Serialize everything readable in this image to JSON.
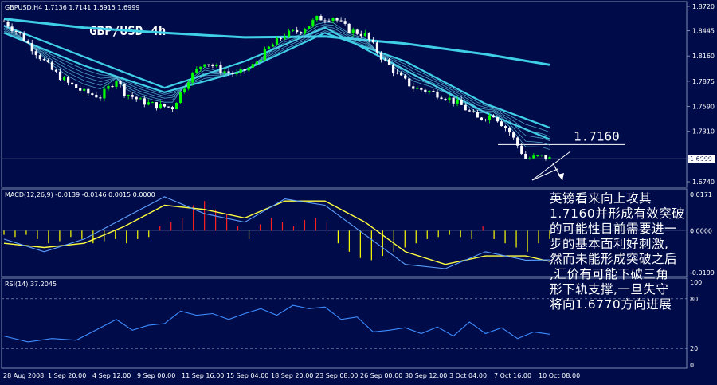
{
  "main_header": "GBPUSD,H4  1.7136 1.7141 1.6915 1.6999",
  "chart_title": "GBP/USD 4h",
  "level_label": "1.7160",
  "price_axis": [
    "1.8720",
    "1.8445",
    "1.8160",
    "1.7875",
    "1.7590",
    "1.7310",
    "1.6999",
    "1.6740"
  ],
  "macd_header": "MACD(12,26,9) -0.0139 -0.0146 0.0015 0.0000",
  "macd_axis": [
    "0.0171",
    "0.0000",
    "-0.0199"
  ],
  "rsi_header": "RSI(14) 37.2045",
  "rsi_axis": [
    "100",
    "80",
    "20",
    "0"
  ],
  "time_axis": [
    "28 Aug 2008",
    "1 Sep 20:00",
    "4 Sep 12:00",
    "9 Sep 00:00",
    "11 Sep 16:00",
    "15 Sep 04:00",
    "18 Sep 20:00",
    "23 Sep 08:00",
    "26 Sep 00:00",
    "30 Sep 12:00",
    "3 Oct 04:00",
    "7 Oct 16:00",
    "10 Oct 08:00"
  ],
  "annotation": [
    "英镑看来向上攻其",
    "1.7160并形成有效突破",
    "的可能性目前需要进一",
    "步的基本面利好刺激,",
    "然而未能形成突破之后",
    ",汇价有可能下破三角",
    "形下轨支撑,一旦失守",
    "将向1.6770方向进展"
  ],
  "colors": {
    "background": "#000c4a",
    "bull_candle": "#00ff00",
    "bear_candle": "#ffffff",
    "ma_slow": "#3fd0e8",
    "ma_fast": "#63c6de",
    "macd_pos": "#ff2020",
    "macd_neg": "#ffff00",
    "macd_signal": "#ffff40",
    "macd_line": "#5fa0ff",
    "rsi_line": "#3d8cff"
  },
  "chart_data": {
    "type": "candlestick",
    "title": "GBP/USD 4h",
    "symbol": "GBPUSD",
    "timeframe": "H4",
    "ohlc_last": {
      "open": 1.7136,
      "high": 1.7141,
      "low": 1.6915,
      "close": 1.6999
    },
    "price_ylim": [
      1.674,
      1.872
    ],
    "close_path": [
      [
        0,
        1.855
      ],
      [
        4,
        1.84
      ],
      [
        8,
        1.82
      ],
      [
        12,
        1.8
      ],
      [
        16,
        1.785
      ],
      [
        20,
        1.775
      ],
      [
        24,
        1.77
      ],
      [
        28,
        1.79
      ],
      [
        30,
        1.775
      ],
      [
        34,
        1.765
      ],
      [
        38,
        1.76
      ],
      [
        42,
        1.758
      ],
      [
        46,
        1.79
      ],
      [
        50,
        1.81
      ],
      [
        54,
        1.8
      ],
      [
        58,
        1.795
      ],
      [
        62,
        1.805
      ],
      [
        66,
        1.825
      ],
      [
        70,
        1.84
      ],
      [
        74,
        1.845
      ],
      [
        78,
        1.858
      ],
      [
        82,
        1.86
      ],
      [
        86,
        1.845
      ],
      [
        90,
        1.84
      ],
      [
        94,
        1.815
      ],
      [
        98,
        1.795
      ],
      [
        102,
        1.78
      ],
      [
        106,
        1.776
      ],
      [
        110,
        1.77
      ],
      [
        114,
        1.76
      ],
      [
        118,
        1.745
      ],
      [
        122,
        1.75
      ],
      [
        126,
        1.73
      ],
      [
        130,
        1.7
      ],
      [
        134,
        1.7025
      ],
      [
        136,
        1.6999
      ]
    ],
    "moving_averages": [
      {
        "values": [
          [
            0,
            1.858
          ],
          [
            20,
            1.848
          ],
          [
            40,
            1.842
          ],
          [
            60,
            1.837
          ],
          [
            80,
            1.838
          ],
          [
            100,
            1.83
          ],
          [
            120,
            1.818
          ],
          [
            136,
            1.806
          ]
        ]
      },
      {
        "values": [
          [
            0,
            1.842
          ],
          [
            20,
            1.805
          ],
          [
            40,
            1.775
          ],
          [
            60,
            1.8
          ],
          [
            80,
            1.842
          ],
          [
            100,
            1.81
          ],
          [
            120,
            1.762
          ],
          [
            136,
            1.735
          ]
        ]
      },
      {
        "values": [
          [
            0,
            1.85
          ],
          [
            20,
            1.815
          ],
          [
            40,
            1.78
          ],
          [
            60,
            1.81
          ],
          [
            80,
            1.848
          ],
          [
            100,
            1.8
          ],
          [
            120,
            1.752
          ],
          [
            136,
            1.722
          ]
        ]
      }
    ],
    "resistance_level": 1.716,
    "macd": {
      "params": "12,26,9",
      "values": [
        -0.0139,
        -0.0146,
        0.0015,
        0.0
      ],
      "ylim": [
        -0.0199,
        0.0171
      ],
      "histogram": [
        -0.002,
        -0.003,
        -0.002,
        -0.004,
        -0.006,
        -0.005,
        -0.003,
        -0.004,
        -0.006,
        -0.005,
        -0.004,
        -0.006,
        -0.004,
        -0.003,
        0.002,
        0.004,
        0.006,
        0.012,
        0.014,
        0.01,
        0.008,
        0.002,
        -0.004,
        0.003,
        0.006,
        0.004,
        0.002,
        0.005,
        0.006,
        0.004,
        -0.006,
        -0.01,
        -0.013,
        -0.014,
        -0.012,
        -0.01,
        -0.008,
        -0.006,
        -0.004,
        -0.003,
        -0.002,
        -0.003,
        -0.004,
        0.002,
        -0.004,
        -0.006,
        -0.008,
        -0.01,
        -0.006,
        -0.004
      ],
      "signal": [
        [
          0,
          -0.006
        ],
        [
          10,
          -0.008
        ],
        [
          20,
          -0.006
        ],
        [
          30,
          0.002
        ],
        [
          40,
          0.012
        ],
        [
          50,
          0.01
        ],
        [
          60,
          0.006
        ],
        [
          70,
          0.014
        ],
        [
          80,
          0.014
        ],
        [
          90,
          0.004
        ],
        [
          100,
          -0.01
        ],
        [
          110,
          -0.016
        ],
        [
          120,
          -0.012
        ],
        [
          130,
          -0.012
        ],
        [
          136,
          -0.0146
        ]
      ],
      "main": [
        [
          0,
          -0.004
        ],
        [
          10,
          -0.01
        ],
        [
          20,
          -0.004
        ],
        [
          30,
          0.006
        ],
        [
          40,
          0.016
        ],
        [
          50,
          0.008
        ],
        [
          60,
          0.004
        ],
        [
          70,
          0.015
        ],
        [
          80,
          0.012
        ],
        [
          90,
          -0.002
        ],
        [
          100,
          -0.016
        ],
        [
          110,
          -0.018
        ],
        [
          120,
          -0.01
        ],
        [
          130,
          -0.014
        ],
        [
          136,
          -0.0139
        ]
      ]
    },
    "rsi": {
      "period": 14,
      "value": 37.2045,
      "levels": [
        80,
        20
      ],
      "ylim": [
        0,
        100
      ],
      "values": [
        [
          0,
          35
        ],
        [
          6,
          28
        ],
        [
          12,
          32
        ],
        [
          18,
          30
        ],
        [
          24,
          45
        ],
        [
          28,
          55
        ],
        [
          32,
          42
        ],
        [
          36,
          48
        ],
        [
          40,
          50
        ],
        [
          44,
          65
        ],
        [
          48,
          60
        ],
        [
          52,
          62
        ],
        [
          56,
          55
        ],
        [
          60,
          62
        ],
        [
          64,
          68
        ],
        [
          68,
          60
        ],
        [
          72,
          72
        ],
        [
          76,
          68
        ],
        [
          80,
          70
        ],
        [
          84,
          55
        ],
        [
          88,
          58
        ],
        [
          92,
          40
        ],
        [
          96,
          42
        ],
        [
          100,
          45
        ],
        [
          104,
          38
        ],
        [
          108,
          46
        ],
        [
          112,
          35
        ],
        [
          116,
          52
        ],
        [
          120,
          38
        ],
        [
          124,
          45
        ],
        [
          128,
          32
        ],
        [
          132,
          40
        ],
        [
          136,
          37.2
        ]
      ]
    },
    "x_labels": [
      "28 Aug 2008",
      "1 Sep 20:00",
      "4 Sep 12:00",
      "9 Sep 00:00",
      "11 Sep 16:00",
      "15 Sep 04:00",
      "18 Sep 20:00",
      "23 Sep 08:00",
      "26 Sep 00:00",
      "30 Sep 12:00",
      "3 Oct 04:00",
      "7 Oct 16:00",
      "10 Oct 08:00"
    ]
  }
}
